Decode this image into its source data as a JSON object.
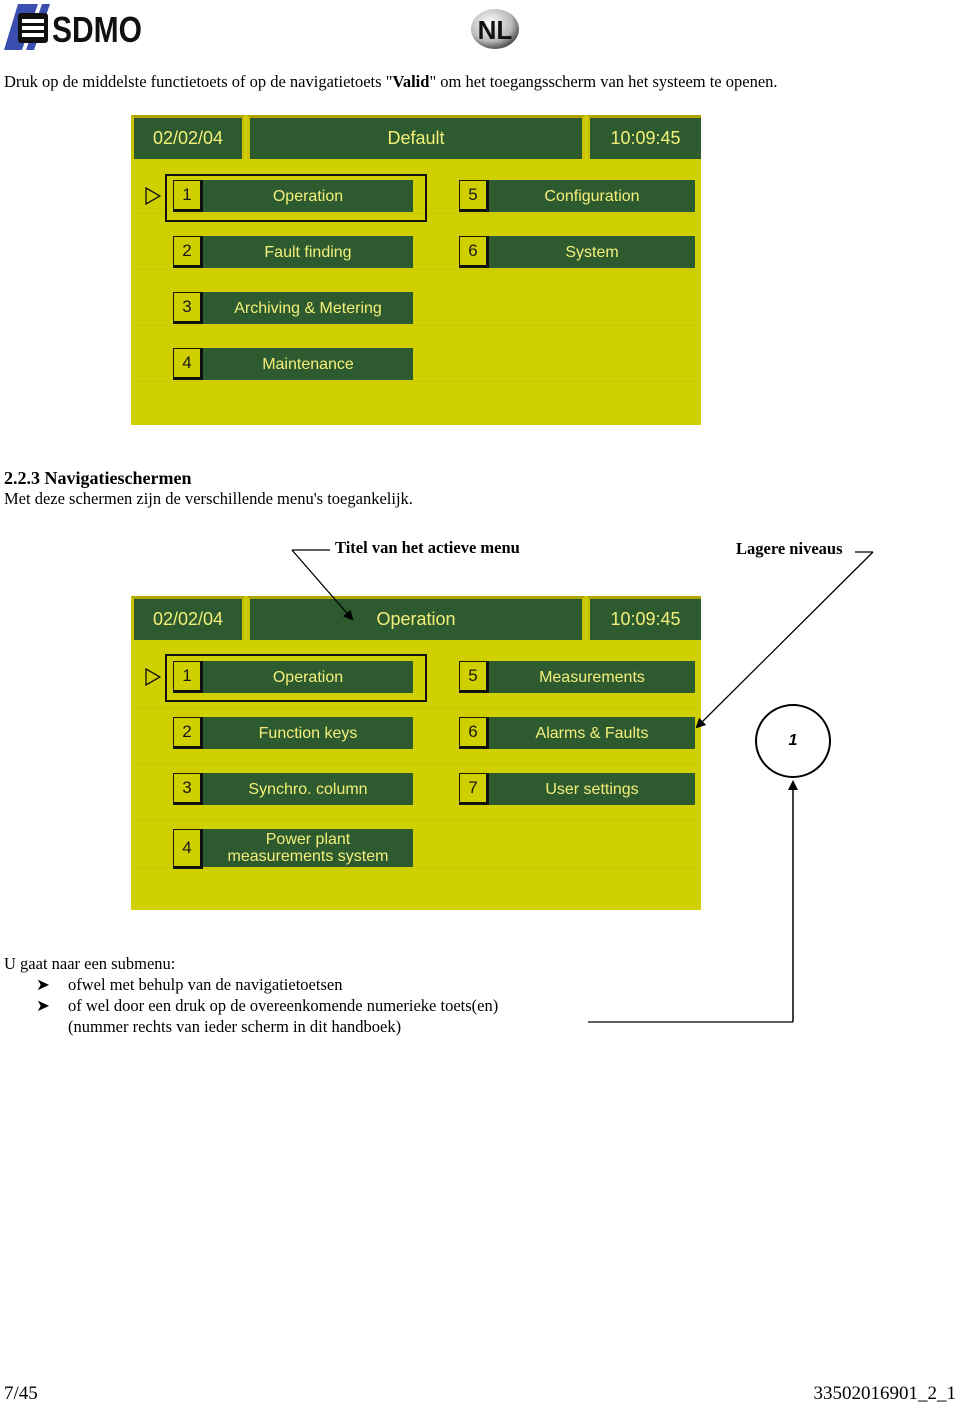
{
  "header": {
    "brand": "SDMO",
    "language_badge": "NL"
  },
  "intro": {
    "before": "Druk op de middelste functietoets of op de navigatietoets \"",
    "bold": "Valid",
    "after": "\" om het toegangsscherm van het systeem te openen."
  },
  "screen1": {
    "date": "02/02/04",
    "title": "Default",
    "time": "10:09:45",
    "selected_index": 1,
    "items": [
      {
        "num": "1",
        "label": "Operation"
      },
      {
        "num": "2",
        "label": "Fault finding"
      },
      {
        "num": "3",
        "label": "Archiving & Metering"
      },
      {
        "num": "4",
        "label": "Maintenance"
      },
      {
        "num": "5",
        "label": "Configuration"
      },
      {
        "num": "6",
        "label": "System"
      }
    ],
    "colors": {
      "panel": "#d0cf00",
      "bar": "#2e5a2f",
      "text": "#f3f07a"
    }
  },
  "section": {
    "title": "2.2.3 Navigatieschermen",
    "description": "Met deze schermen zijn de verschillende menu's toegankelijk."
  },
  "callouts": {
    "active_menu_title": "Titel van het actieve menu",
    "lower_levels": "Lagere niveaus",
    "screen_number": "1"
  },
  "screen2": {
    "date": "02/02/04",
    "title": "Operation",
    "time": "10:09:45",
    "selected_index": 1,
    "items": [
      {
        "num": "1",
        "label": "Operation"
      },
      {
        "num": "2",
        "label": "Function keys"
      },
      {
        "num": "3",
        "label": "Synchro. column"
      },
      {
        "num": "4",
        "label": "Power plant measurements system"
      },
      {
        "num": "5",
        "label": "Measurements"
      },
      {
        "num": "6",
        "label": "Alarms & Faults"
      },
      {
        "num": "7",
        "label": "User settings"
      }
    ]
  },
  "submenu": {
    "heading": "U gaat naar een submenu:",
    "bullets": [
      "ofwel met behulp van de navigatietoetsen",
      "of wel door een druk op de overeenkomende numerieke toets(en)"
    ],
    "note": "(nummer rechts van ieder scherm in dit handboek)"
  },
  "footer": {
    "page": "7/45",
    "doc_ref": "33502016901_2_1"
  }
}
